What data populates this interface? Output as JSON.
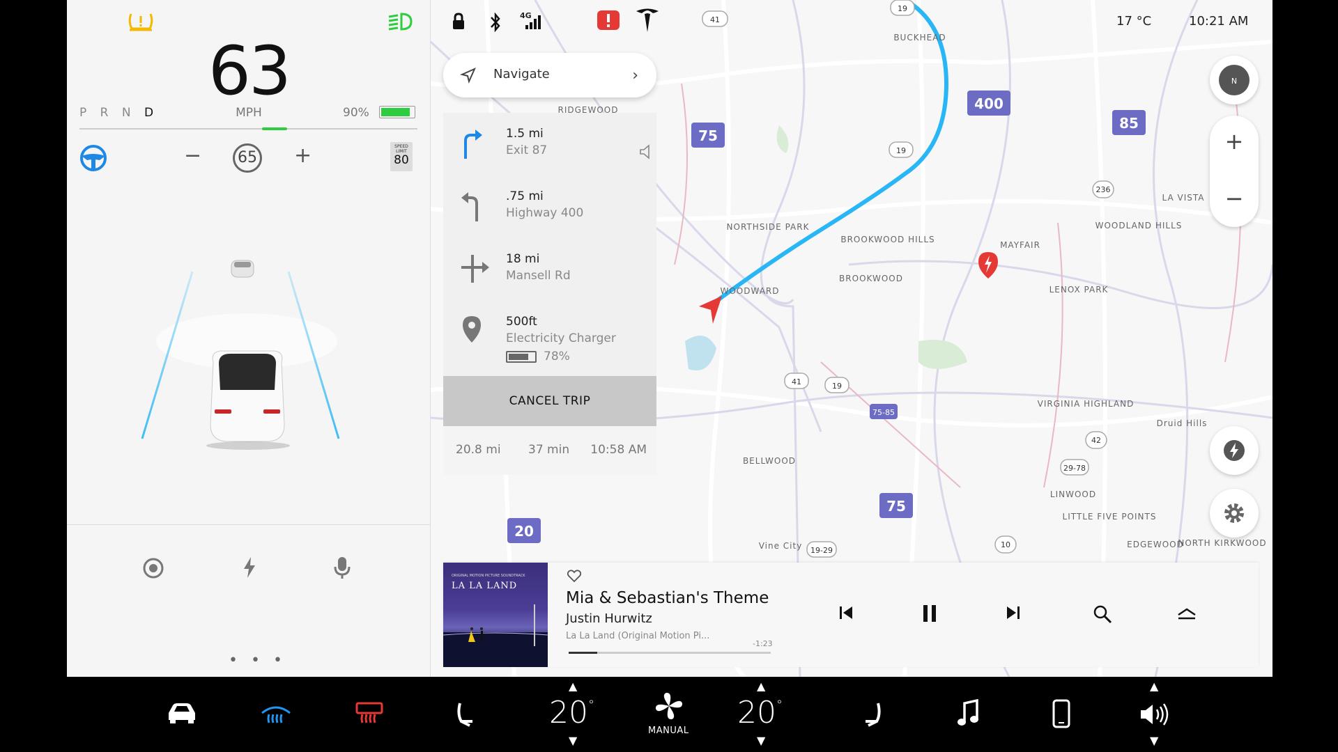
{
  "driving": {
    "speed": "63",
    "gears": [
      "P",
      "R",
      "N"
    ],
    "gear_active": "D",
    "unit": "MPH",
    "battery_pct": "90%",
    "battery_level": 0.9,
    "set_speed": "65",
    "speed_limit_label": "SPEED LIMIT",
    "speed_limit": "80",
    "minus": "−",
    "plus": "+",
    "more": "• • •"
  },
  "status": {
    "network": "4G",
    "temperature": "17 °C",
    "time": "10:21 AM"
  },
  "navigation": {
    "navigate_label": "Navigate",
    "steps": [
      {
        "distance": "1.5 mi",
        "name": "Exit 87",
        "icon": "turn-right-icon"
      },
      {
        "distance": ".75 mi",
        "name": "Highway 400",
        "icon": "turn-left-icon"
      },
      {
        "distance": "18 mi",
        "name": "Mansell Rd",
        "icon": "cross-intersection-icon"
      },
      {
        "distance": "500ft",
        "name": "Electricity Charger",
        "charge": "78%",
        "icon": "location-pin-icon"
      }
    ],
    "cancel_label": "CANCEL TRIP",
    "summary": {
      "distance": "20.8 mi",
      "duration": "37 min",
      "arrival": "10:58 AM"
    }
  },
  "map": {
    "compass": "N",
    "zoom_in": "+",
    "zoom_out": "−",
    "labels": [
      "BUCKHEAD",
      "RIDGEWOOD",
      "NORTHSIDE PARK",
      "BROOKWOOD HILLS",
      "BROOKWOOD",
      "WOODWARD",
      "MAYFAIR",
      "LENOX PARK",
      "WOODLAND HILLS",
      "LA VISTA",
      "VIRGINIA HIGHLAND",
      "Druid Hills",
      "BELLWOOD",
      "LINWOOD",
      "LITTLE FIVE POINTS",
      "EDGEWOOD",
      "NORTH KIRKWOOD",
      "Vine City"
    ],
    "shields": [
      "75",
      "400",
      "85",
      "75",
      "20",
      "41",
      "19",
      "19",
      "41",
      "19",
      "236",
      "42",
      "29-78",
      "10",
      "19-29",
      "75-85"
    ]
  },
  "media": {
    "album_art_title": "LA LA LAND",
    "album_art_subtitle": "ORIGINAL MOTION PICTURE SOUNDTRACK",
    "track": "Mia & Sebastian's Theme",
    "artist": "Justin Hurwitz",
    "album": "La La Land (Original Motion Pi...",
    "remaining": "-1:23",
    "progress": 0.14
  },
  "climate": {
    "driver_temp": "20",
    "passenger_temp": "20",
    "degree": "°",
    "fan_mode": "MANUAL"
  },
  "colors": {
    "route": "#29b6f6",
    "accent": "#1e88e5",
    "battery": "#2ecc40",
    "alert": "#e53935",
    "warning": "#f5b800",
    "shield": "#6c6cc4"
  }
}
